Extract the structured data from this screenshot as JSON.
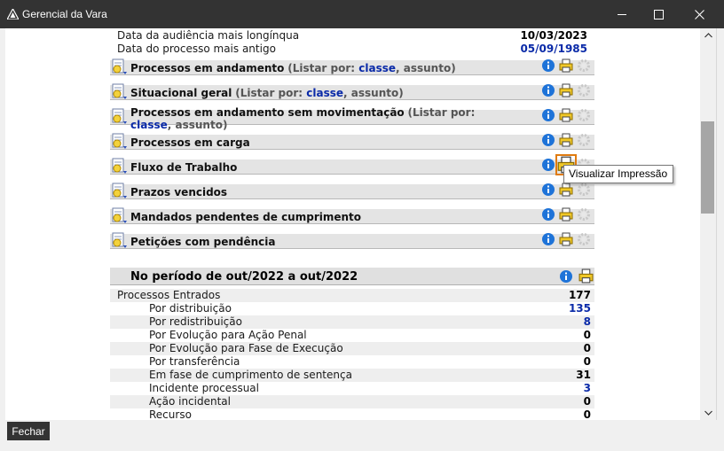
{
  "window": {
    "title": "Gerencial da Vara"
  },
  "summary": [
    {
      "label": "Data da audiência mais longínqua",
      "value": "10/03/2023",
      "color": "#000000"
    },
    {
      "label": "Data do processo mais antigo",
      "value": "05/09/1985",
      "color": "#0a2aa8"
    }
  ],
  "sections": [
    {
      "title": "Processos em andamento",
      "list_prefix": "(Listar por: ",
      "link1": "classe",
      "sep": ", ",
      "link2": "assunto",
      "suffix": ")"
    },
    {
      "title": "Situacional geral",
      "list_prefix": "(Listar por: ",
      "link1": "classe",
      "sep": ", ",
      "link2": "assunto",
      "suffix": ")"
    },
    {
      "title": "Processos em andamento sem movimentação",
      "list_prefix": "(Listar por: ",
      "link1": "classe",
      "sep": ", ",
      "link2": "assunto",
      "suffix": ")"
    },
    {
      "title": "Processos em carga"
    },
    {
      "title": "Fluxo de Trabalho"
    },
    {
      "title": "Prazos vencidos"
    },
    {
      "title": "Mandados pendentes de cumprimento"
    },
    {
      "title": "Petições com pendência"
    }
  ],
  "tooltip": "Visualizar Impressão",
  "period": {
    "title": "No período de  out/2022 a out/2022"
  },
  "stats": [
    {
      "label": "Processos Entrados",
      "value": "177",
      "color": "#000000",
      "indent": false
    },
    {
      "label": "Por distribuição",
      "value": "135",
      "color": "#0a2aa8",
      "indent": true
    },
    {
      "label": "Por redistribuição",
      "value": "8",
      "color": "#0a2aa8",
      "indent": true
    },
    {
      "label": "Por Evolução para Ação Penal",
      "value": "0",
      "color": "#000000",
      "indent": true
    },
    {
      "label": "Por Evolução para Fase de Execução",
      "value": "0",
      "color": "#000000",
      "indent": true
    },
    {
      "label": "Por transferência",
      "value": "0",
      "color": "#000000",
      "indent": true
    },
    {
      "label": "Em fase de cumprimento de sentença",
      "value": "31",
      "color": "#000000",
      "indent": true
    },
    {
      "label": "Incidente processual",
      "value": "3",
      "color": "#0a2aa8",
      "indent": true
    },
    {
      "label": "Ação incidental",
      "value": "0",
      "color": "#000000",
      "indent": true
    },
    {
      "label": "Recurso",
      "value": "0",
      "color": "#000000",
      "indent": true
    }
  ],
  "footer": {
    "close_label": "Fechar"
  },
  "icons": {
    "info": "info-icon",
    "print": "print-preview-icon",
    "gear": "gear-icon",
    "section": "report-icon"
  }
}
